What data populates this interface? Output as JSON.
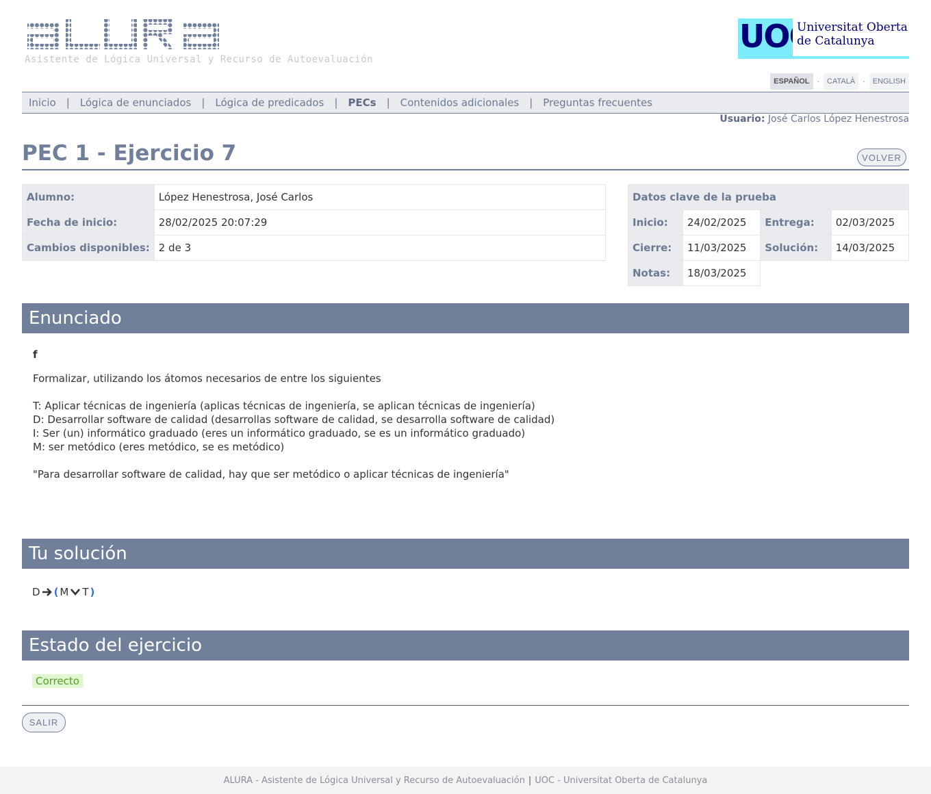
{
  "header": {
    "logo_subtitle": "Asistente de Lógica Universal y Recurso de Autoevaluación",
    "uoc_mark": "UOC",
    "uoc_name_line1": "Universitat Oberta",
    "uoc_name_line2": "de Catalunya",
    "languages": [
      "ESPAÑOL",
      "CATALÀ",
      "ENGLISH"
    ],
    "active_language": "ESPAÑOL"
  },
  "nav": {
    "items": [
      "Inicio",
      "Lógica de enunciados",
      "Lógica de predicados",
      "PECs",
      "Contenidos adicionales",
      "Preguntas frecuentes"
    ],
    "active": "PECs",
    "separator": "|"
  },
  "user": {
    "label": "Usuario:",
    "name": "José Carlos López Henestrosa"
  },
  "page": {
    "title": "PEC 1 - Ejercicio 7",
    "back_label": "VOLVER",
    "exit_label": "SALIR"
  },
  "alumno": {
    "rows": [
      {
        "label": "Alumno:",
        "value": "López Henestrosa, José Carlos"
      },
      {
        "label": "Fecha de inicio:",
        "value": "28/02/2025 20:07:29"
      },
      {
        "label": "Cambios disponibles:",
        "value": "2 de 3"
      }
    ]
  },
  "datos": {
    "header": "Datos clave de la prueba",
    "inicio_label": "Inicio:",
    "inicio": "24/02/2025",
    "entrega_label": "Entrega:",
    "entrega": "02/03/2025",
    "cierre_label": "Cierre:",
    "cierre": "11/03/2025",
    "solucion_label": "Solución:",
    "solucion": "14/03/2025",
    "notas_label": "Notas:",
    "notas": "18/03/2025"
  },
  "enunciado": {
    "heading": "Enunciado",
    "letter": "f",
    "intro": "Formalizar, utilizando los átomos necesarios de entre los siguientes",
    "atoms": [
      "T: Aplicar técnicas de ingeniería (aplicas técnicas de ingeniería, se aplican técnicas de ingeniería)",
      "D: Desarrollar software de calidad (desarrollas software de calidad, se desarrolla software de calidad)",
      "I: Ser (un) informático graduado (eres un informático graduado, se es un informático graduado)",
      "M: ser metódico (eres metódico, se es metódico)"
    ],
    "sentence": "\"Para desarrollar software de calidad, hay que ser metódico o aplicar técnicas de ingeniería\""
  },
  "solucion": {
    "heading": "Tu solución",
    "antecedent": "D",
    "open_paren": "(",
    "left": "M",
    "right": "T",
    "close_paren": ")"
  },
  "estado": {
    "heading": "Estado del ejercicio",
    "status": "Correcto"
  },
  "footer": {
    "left": "ALURA - Asistente de Lógica Universal y Recurso de Autoevaluación",
    "sep": "|",
    "right": "UOC - Universitat Oberta de Catalunya"
  }
}
